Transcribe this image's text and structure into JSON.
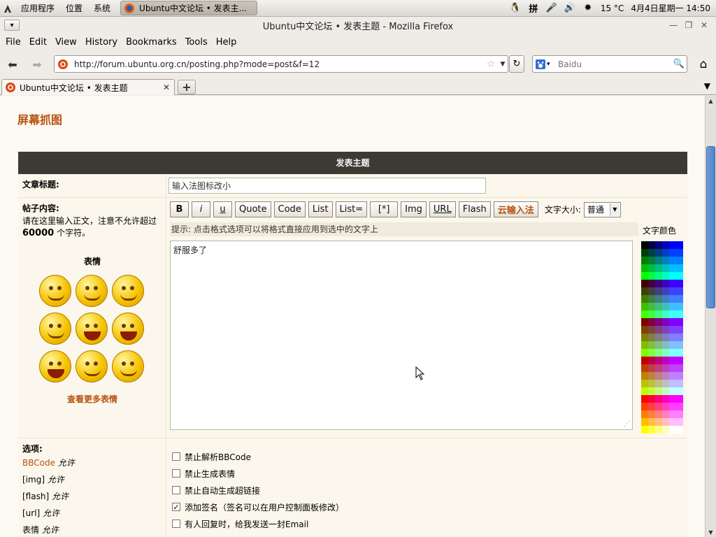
{
  "gnome_panel": {
    "menus": [
      "应用程序",
      "位置",
      "系统"
    ],
    "task_title": "Ubuntu中文论坛 • 发表主...",
    "tray": {
      "ime": "拼",
      "weather": "15 °C",
      "clock": "4月4日星期一 14:50"
    }
  },
  "window": {
    "title": "Ubuntu中文论坛 • 发表主题 - Mozilla Firefox"
  },
  "menubar": {
    "items": [
      "File",
      "Edit",
      "View",
      "History",
      "Bookmarks",
      "Tools",
      "Help"
    ]
  },
  "navbar": {
    "url": "http://forum.ubuntu.org.cn/posting.php?mode=post&f=12",
    "search_placeholder": "Baidu"
  },
  "tabs": [
    {
      "label": "Ubuntu中文论坛 • 发表主题"
    }
  ],
  "page": {
    "heading": "屏幕抓图",
    "panel_title": "发表主题",
    "subject_label": "文章标题:",
    "subject_value": "输入法图标改小",
    "body_label": "帖子内容:",
    "body_hint_pre": "请在这里输入正文，注意不允许超过",
    "body_hint_limit": "60000",
    "body_hint_post": "个字符。",
    "smilies_title": "表情",
    "more_smilies": "查看更多表情",
    "toolbar": {
      "buttons": [
        "B",
        "i",
        "u",
        "Quote",
        "Code",
        "List",
        "List=",
        "[*]",
        "Img",
        "URL",
        "Flash",
        "云输入法"
      ],
      "font_size_label": "文字大小:",
      "font_size_value": "普通"
    },
    "tip": "提示:  点击格式选项可以将格式直接应用到选中的文字上",
    "color_label": "文字颜色",
    "message": "舒服多了",
    "options_label": "选项:",
    "permissions": [
      {
        "name": "BBCode",
        "status": "允许"
      },
      {
        "name": "[img]",
        "status": "允许"
      },
      {
        "name": "[flash]",
        "status": "允许"
      },
      {
        "name": "[url]",
        "status": "允许"
      },
      {
        "name": "表情",
        "status": "允许"
      }
    ],
    "options": [
      {
        "label": "禁止解析BBCode",
        "checked": false
      },
      {
        "label": "禁止生成表情",
        "checked": false
      },
      {
        "label": "禁止自动生成超链接",
        "checked": false
      },
      {
        "label": "添加签名（签名可以在用户控制面板修改）",
        "checked": true
      },
      {
        "label": "有人回复时，给我发送一封Email",
        "checked": false
      }
    ]
  },
  "colors": {
    "accent": "#b8520f",
    "panel_dark": "#3d3a35"
  }
}
